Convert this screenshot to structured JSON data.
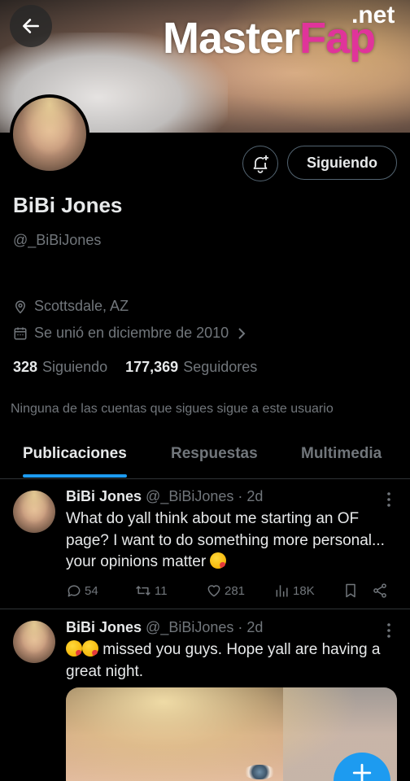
{
  "profile": {
    "name": "BiBi Jones",
    "handle": "@_BiBiJones",
    "location": "Scottsdale, AZ",
    "joined": "Se unió en diciembre de 2010",
    "following_count": "328",
    "following_label": "Siguiendo",
    "followers_count": "177,369",
    "followers_label": "Seguidores",
    "mutuals_note": "Ninguna de las cuentas que sigues sigue a este usuario"
  },
  "header": {
    "follow_button_label": "Siguiendo",
    "watermark_part1": "Master",
    "watermark_part2": "Fap",
    "watermark_suffix": ".net"
  },
  "tabs": [
    {
      "label": "Publicaciones",
      "active": true
    },
    {
      "label": "Respuestas",
      "active": false
    },
    {
      "label": "Multimedia",
      "active": false
    }
  ],
  "posts": [
    {
      "name": "BiBi Jones",
      "meta": "@_BiBiJones · 2d",
      "text": "What do yall think about me starting an OF page? I want to do something more personal... your opinions matter",
      "emoji": "kissing-face-with-heart",
      "replies": "54",
      "reposts": "11",
      "likes": "281",
      "views": "18K"
    },
    {
      "name": "BiBi Jones",
      "meta": "@_BiBiJones · 2d",
      "text": "missed you guys. Hope yall are having a great night.",
      "emoji": "kissing-face-with-heart"
    }
  ],
  "colors": {
    "accent": "#1d9bf0",
    "background": "#000000",
    "text_primary": "#e7e9ea",
    "text_secondary": "#71767b",
    "border": "#2f3336"
  },
  "icons": {
    "back": "arrow-left-icon",
    "notify": "bell-plus-icon",
    "location": "location-pin-icon",
    "calendar": "calendar-icon",
    "reply": "reply-icon",
    "repost": "repost-icon",
    "like": "heart-icon",
    "views": "views-icon",
    "bookmark": "bookmark-icon",
    "share": "share-icon",
    "more": "more-dots-icon",
    "compose": "plus-icon"
  }
}
